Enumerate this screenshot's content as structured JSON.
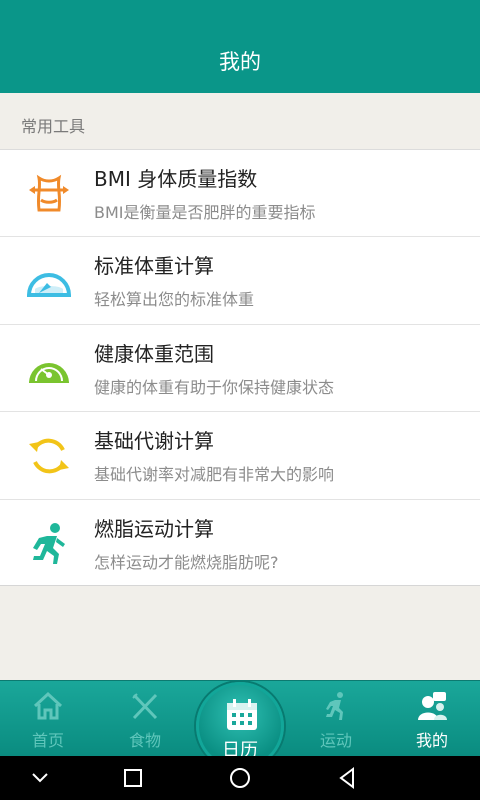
{
  "header": {
    "title": "我的"
  },
  "section": {
    "label": "常用工具"
  },
  "tools": [
    {
      "title": "BMI 身体质量指数",
      "subtitle": "BMI是衡量是否肥胖的重要指标",
      "icon": "waist-measure-icon",
      "color": "#f08a2a"
    },
    {
      "title": "标准体重计算",
      "subtitle": "轻松算出您的标准体重",
      "icon": "scale-gauge-icon",
      "color": "#3dbde3"
    },
    {
      "title": "健康体重范围",
      "subtitle": "健康的体重有助于你保持健康状态",
      "icon": "health-gauge-icon",
      "color": "#7ac42f"
    },
    {
      "title": "基础代谢计算",
      "subtitle": "基础代谢率对减肥有非常大的影响",
      "icon": "cycle-arrows-icon",
      "color": "#f2c418"
    },
    {
      "title": "燃脂运动计算",
      "subtitle": "怎样运动才能燃烧脂肪呢?",
      "icon": "running-man-icon",
      "color": "#1fb79a"
    }
  ],
  "tabs": {
    "home": "首页",
    "discover": "食物",
    "calendar": "日历",
    "exercise": "运动",
    "mine": "我的"
  },
  "colors": {
    "primary": "#0a9689",
    "tab_inactive": "#5fc6bb"
  }
}
